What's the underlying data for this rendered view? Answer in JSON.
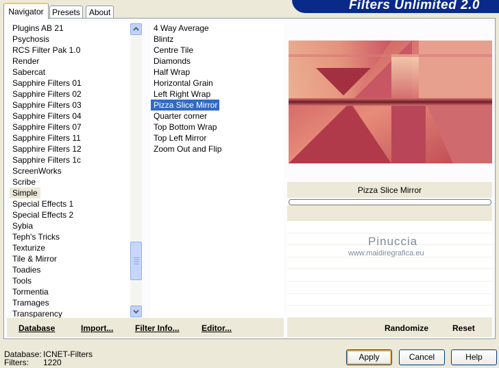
{
  "banner": {
    "title": "Filters Unlimited 2.0"
  },
  "tabs": [
    {
      "label": "Navigator",
      "active": true
    },
    {
      "label": "Presets",
      "active": false
    },
    {
      "label": "About",
      "active": false
    }
  ],
  "categories": {
    "items": [
      "Plugins AB 21",
      "Psychosis",
      "RCS Filter Pak 1.0",
      "Render",
      "Sabercat",
      "Sapphire Filters 01",
      "Sapphire Filters 02",
      "Sapphire Filters 03",
      "Sapphire Filters 04",
      "Sapphire Filters 07",
      "Sapphire Filters 11",
      "Sapphire Filters 12",
      "Sapphire Filters 1c",
      "ScreenWorks",
      "Scribe",
      "Simple",
      "Special Effects 1",
      "Special Effects 2",
      "Sybia",
      "Teph's Tricks",
      "Texturize",
      "Tile & Mirror",
      "Toadies",
      "Tools",
      "Tormentia",
      "Tramages",
      "Transparency"
    ],
    "selected": "Simple"
  },
  "filters": {
    "items": [
      "4 Way Average",
      "Blintz",
      "Centre Tile",
      "Diamonds",
      "Half Wrap",
      "Horizontal Grain",
      "Left Right Wrap",
      "Pizza Slice Mirror",
      "Quarter corner",
      "Top Bottom Wrap",
      "Top Left Mirror",
      "Zoom Out and Flip"
    ],
    "selected": "Pizza Slice Mirror"
  },
  "preview": {
    "filter_name": "Pizza Slice Mirror"
  },
  "watermark": {
    "name": "Pinuccia",
    "site": "www.maidiregrafica.eu"
  },
  "left_buttons": {
    "database": "Database",
    "import": "Import...",
    "filter_info": "Filter Info...",
    "editor": "Editor..."
  },
  "right_buttons": {
    "randomize": "Randomize",
    "reset": "Reset"
  },
  "footer": {
    "database_label": "Database:",
    "database_value": "ICNET-Filters",
    "filters_label": "Filters:",
    "filters_value": "1220"
  },
  "dialog_buttons": {
    "apply": "Apply",
    "cancel": "Cancel",
    "help": "Help"
  }
}
